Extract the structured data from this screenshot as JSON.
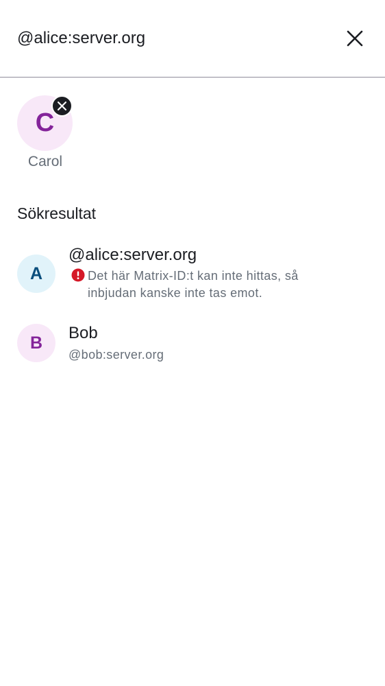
{
  "search": {
    "value": "@alice:server.org",
    "close_icon": "close-icon"
  },
  "selected": [
    {
      "initial": "C",
      "name": "Carol",
      "avatar_bg": "#f8e8f8",
      "avatar_fg": "#84249a",
      "remove_icon": "close-icon"
    }
  ],
  "results": {
    "title": "Sökresultat",
    "items": [
      {
        "initial": "A",
        "title": "@alice:server.org",
        "warning": "Det här Matrix-ID:t kan inte hittas, så inbjudan kanske inte tas emot.",
        "warning_icon": "error-icon",
        "avatar_bg": "#e1f3fa",
        "avatar_fg": "#0a4e7c"
      },
      {
        "initial": "B",
        "title": "Bob",
        "subtitle": "@bob:server.org",
        "avatar_bg": "#f8e8f8",
        "avatar_fg": "#84249a"
      }
    ]
  },
  "colors": {
    "error": "#d51928",
    "text_primary": "#1b1d22",
    "text_secondary": "#656d77"
  }
}
